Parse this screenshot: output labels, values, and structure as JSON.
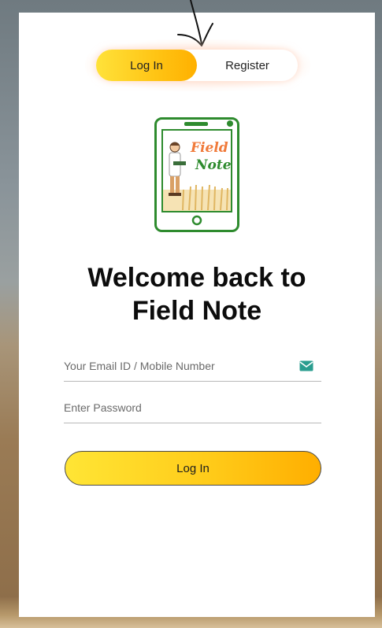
{
  "tabs": [
    {
      "label": "Log In",
      "active": true
    },
    {
      "label": "Register",
      "active": false
    }
  ],
  "logo": {
    "line1": "Field",
    "line2": "Note"
  },
  "heading": {
    "line1": "Welcome back to",
    "line2": "Field Note"
  },
  "form": {
    "email_placeholder": "Your Email ID / Mobile Number",
    "password_placeholder": "Enter Password",
    "submit_label": "Log In"
  },
  "colors": {
    "accent_start": "#ffe535",
    "accent_end": "#ffae00",
    "logo_green": "#2e8b2e",
    "logo_orange": "#f07a3a",
    "mail_icon": "#2a9d8f"
  },
  "icons": {
    "email": "mail-icon",
    "annotation": "arrow-icon"
  }
}
